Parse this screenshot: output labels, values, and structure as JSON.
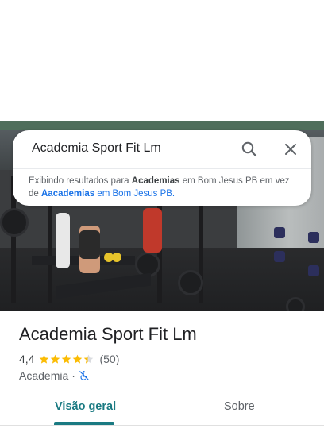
{
  "search": {
    "query": "Academia Sport Fit Lm",
    "notice": {
      "prefix": "Exibindo resultados para",
      "corrected_term": "Academias",
      "corrected_location": "em Bom Jesus PB em",
      "middle": "vez de",
      "original_term": "Aacademias",
      "original_location": "em Bom Jesus PB."
    }
  },
  "place": {
    "title": "Academia Sport Fit Lm",
    "rating": "4,4",
    "stars_value": 4.4,
    "reviews": "(50)",
    "category": "Academia",
    "separator": "·"
  },
  "tabs": [
    {
      "label": "Visão geral",
      "active": true
    },
    {
      "label": "Sobre",
      "active": false
    }
  ],
  "colors": {
    "accent": "#1a7a82",
    "star": "#fbbc04",
    "link": "#1a73e8"
  },
  "icons": {
    "search": "search-icon",
    "close": "close-icon",
    "accessibility": "wheelchair-not-accessible-icon"
  }
}
